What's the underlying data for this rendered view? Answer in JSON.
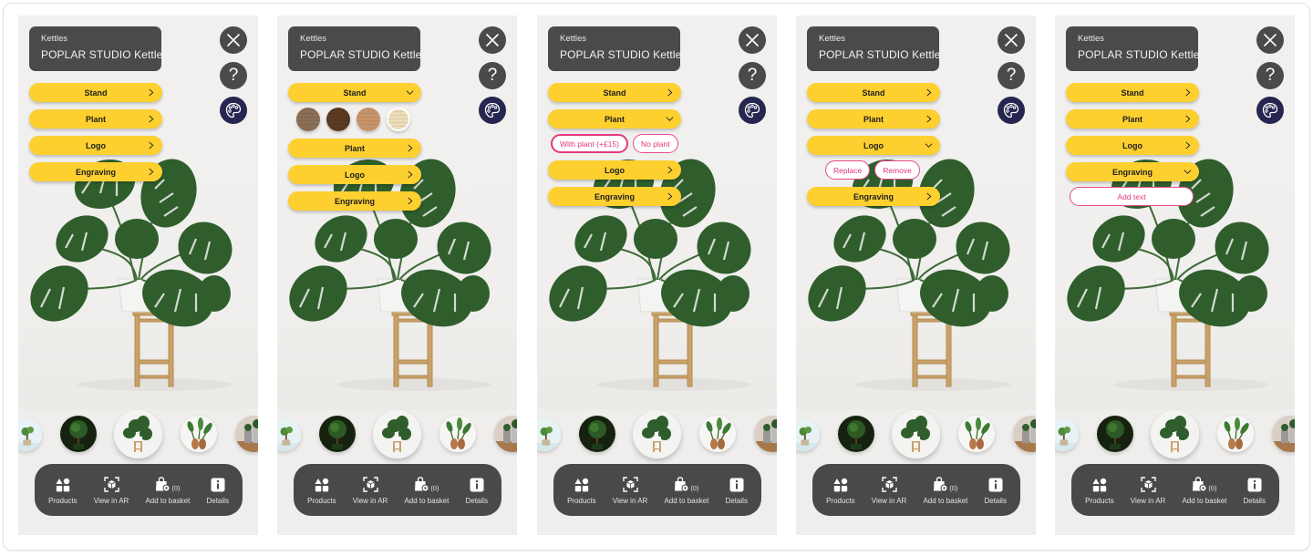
{
  "screens": [
    {
      "title_category": "Kettles",
      "title_product": "POPLAR STUDIO  Kettle",
      "options": [
        {
          "label": "Stand",
          "state": "collapsed"
        },
        {
          "label": "Plant",
          "state": "collapsed"
        },
        {
          "label": "Logo",
          "state": "collapsed"
        },
        {
          "label": "Engraving",
          "state": "collapsed"
        }
      ]
    },
    {
      "title_category": "Kettles",
      "title_product": "POPLAR STUDIO  Kettle",
      "options": [
        {
          "label": "Stand",
          "state": "expanded"
        },
        {
          "label": "Plant",
          "state": "collapsed"
        },
        {
          "label": "Logo",
          "state": "collapsed"
        },
        {
          "label": "Engraving",
          "state": "collapsed"
        }
      ],
      "stand_swatches": [
        {
          "name": "rustic-wood",
          "color": "#8a6f55",
          "selected": false
        },
        {
          "name": "dark-walnut",
          "color": "#5b3a22",
          "selected": false
        },
        {
          "name": "light-oak",
          "color": "#c7946a",
          "selected": false
        },
        {
          "name": "birch",
          "color": "#ecdcb8",
          "selected": true
        }
      ]
    },
    {
      "title_category": "Kettles",
      "title_product": "POPLAR STUDIO  Kettle",
      "options": [
        {
          "label": "Stand",
          "state": "collapsed"
        },
        {
          "label": "Plant",
          "state": "expanded"
        },
        {
          "label": "Logo",
          "state": "collapsed"
        },
        {
          "label": "Engraving",
          "state": "collapsed"
        }
      ],
      "plant_choices": [
        {
          "label": "With plant (+£15)",
          "selected": true
        },
        {
          "label": "No plant",
          "selected": false
        }
      ]
    },
    {
      "title_category": "Kettles",
      "title_product": "POPLAR STUDIO  Kettle",
      "options": [
        {
          "label": "Stand",
          "state": "collapsed"
        },
        {
          "label": "Plant",
          "state": "collapsed"
        },
        {
          "label": "Logo",
          "state": "expanded"
        },
        {
          "label": "Engraving",
          "state": "collapsed"
        }
      ],
      "logo_actions": [
        {
          "label": "Replace"
        },
        {
          "label": "Remove"
        }
      ]
    },
    {
      "title_category": "Kettles",
      "title_product": "POPLAR STUDIO  Kettle",
      "options": [
        {
          "label": "Stand",
          "state": "collapsed"
        },
        {
          "label": "Plant",
          "state": "collapsed"
        },
        {
          "label": "Logo",
          "state": "collapsed"
        },
        {
          "label": "Engraving",
          "state": "expanded"
        }
      ],
      "engraving_action": {
        "label": "Add text"
      }
    }
  ],
  "top_buttons": {
    "close_icon": "close-icon",
    "help_label": "?",
    "palette_icon": "palette-icon"
  },
  "carousel": [
    {
      "name": "bonsai-glass-vase",
      "selected": false
    },
    {
      "name": "topiary-tree",
      "selected": false
    },
    {
      "name": "monstera-on-stand",
      "selected": true
    },
    {
      "name": "banana-plant-copper-vase",
      "selected": false
    },
    {
      "name": "plant-in-metal-pots",
      "selected": false
    }
  ],
  "bottom_nav": {
    "products": "Products",
    "view_ar": "View in AR",
    "add_basket": "Add to basket",
    "basket_count": "(0)",
    "details": "Details"
  },
  "colors": {
    "accent_yellow": "#fdd02f",
    "chip_pink": "#e2367d",
    "dark_panel": "#4a4a48",
    "palette_navy": "#262650"
  }
}
